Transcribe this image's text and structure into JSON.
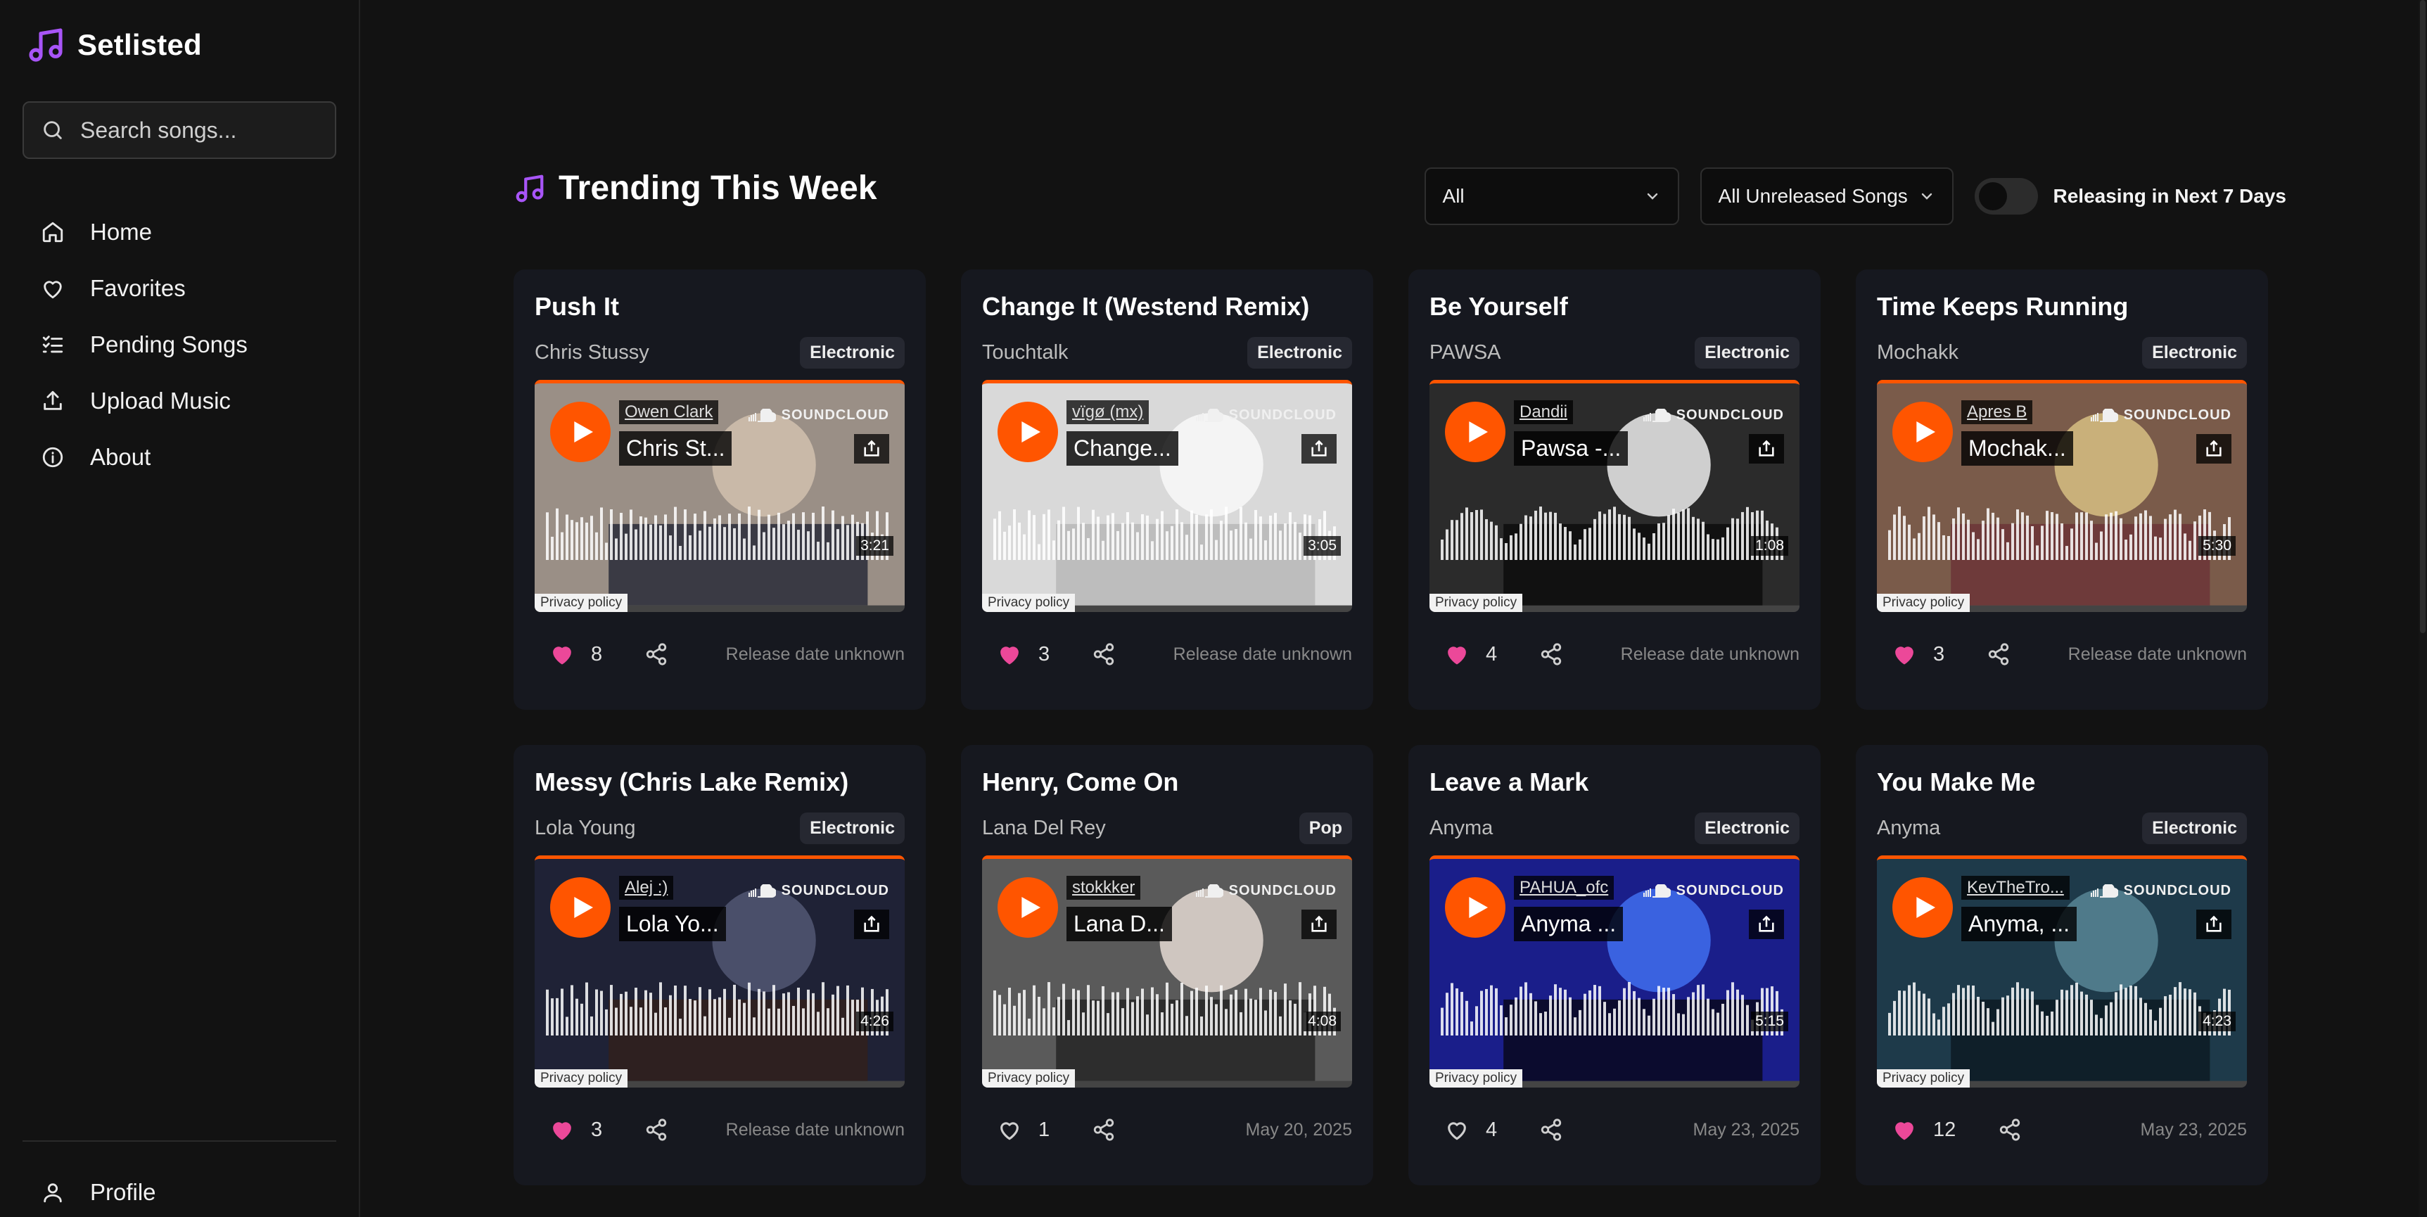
{
  "app": {
    "name": "Setlisted",
    "accent": "#a855f7"
  },
  "search": {
    "placeholder": "Search songs..."
  },
  "nav": {
    "items": [
      {
        "label": "Home",
        "icon": "home-icon"
      },
      {
        "label": "Favorites",
        "icon": "heart-icon"
      },
      {
        "label": "Pending Songs",
        "icon": "checklist-icon"
      },
      {
        "label": "Upload Music",
        "icon": "upload-icon"
      },
      {
        "label": "About",
        "icon": "info-icon"
      }
    ],
    "profile": "Profile"
  },
  "section": {
    "title": "Trending This Week"
  },
  "filters": {
    "genre": "All",
    "status": "All Unreleased Songs",
    "toggle_label": "Releasing in Next 7 Days",
    "toggle_on": false
  },
  "embed": {
    "soundcloud": "SOUNDCLOUD",
    "privacy": "Privacy policy",
    "brand_color": "#ff5500"
  },
  "songs": [
    {
      "title": "Push It",
      "artist": "Chris Stussy",
      "genre": "Electronic",
      "uploader": "Owen Clark",
      "track": "Chris St...",
      "duration": "3:21",
      "likes": "8",
      "liked": true,
      "release": "Release date unknown"
    },
    {
      "title": "Change It (Westend Remix)",
      "artist": "Touchtalk",
      "genre": "Electronic",
      "uploader": "vïgø (mx)",
      "track": "Change...",
      "duration": "3:05",
      "likes": "3",
      "liked": true,
      "release": "Release date unknown"
    },
    {
      "title": "Be Yourself",
      "artist": "PAWSA",
      "genre": "Electronic",
      "uploader": "Dandii",
      "track": "Pawsa -...",
      "duration": "1:08",
      "likes": "4",
      "liked": true,
      "release": "Release date unknown"
    },
    {
      "title": "Time Keeps Running",
      "artist": "Mochakk",
      "genre": "Electronic",
      "uploader": "Apres B",
      "track": "Mochak...",
      "duration": "5:30",
      "likes": "3",
      "liked": true,
      "release": "Release date unknown"
    },
    {
      "title": "Messy (Chris Lake Remix)",
      "artist": "Lola Young",
      "genre": "Electronic",
      "uploader": "Alej :)",
      "track": "Lola Yo...",
      "duration": "4:26",
      "likes": "3",
      "liked": true,
      "release": "Release date unknown"
    },
    {
      "title": "Henry, Come On",
      "artist": "Lana Del Rey",
      "genre": "Pop",
      "uploader": "stokkker",
      "track": "Lana D...",
      "duration": "4:08",
      "likes": "1",
      "liked": false,
      "release": "May 20, 2025"
    },
    {
      "title": "Leave a Mark",
      "artist": "Anyma",
      "genre": "Electronic",
      "uploader": "PAHUA_ofc",
      "track": "Anyma ...",
      "duration": "5:15",
      "likes": "4",
      "liked": false,
      "release": "May 23, 2025"
    },
    {
      "title": "You Make Me",
      "artist": "Anyma",
      "genre": "Electronic",
      "uploader": "KevTheTro...",
      "track": "Anyma, ...",
      "duration": "4:23",
      "likes": "12",
      "liked": true,
      "release": "May 23, 2025"
    }
  ]
}
